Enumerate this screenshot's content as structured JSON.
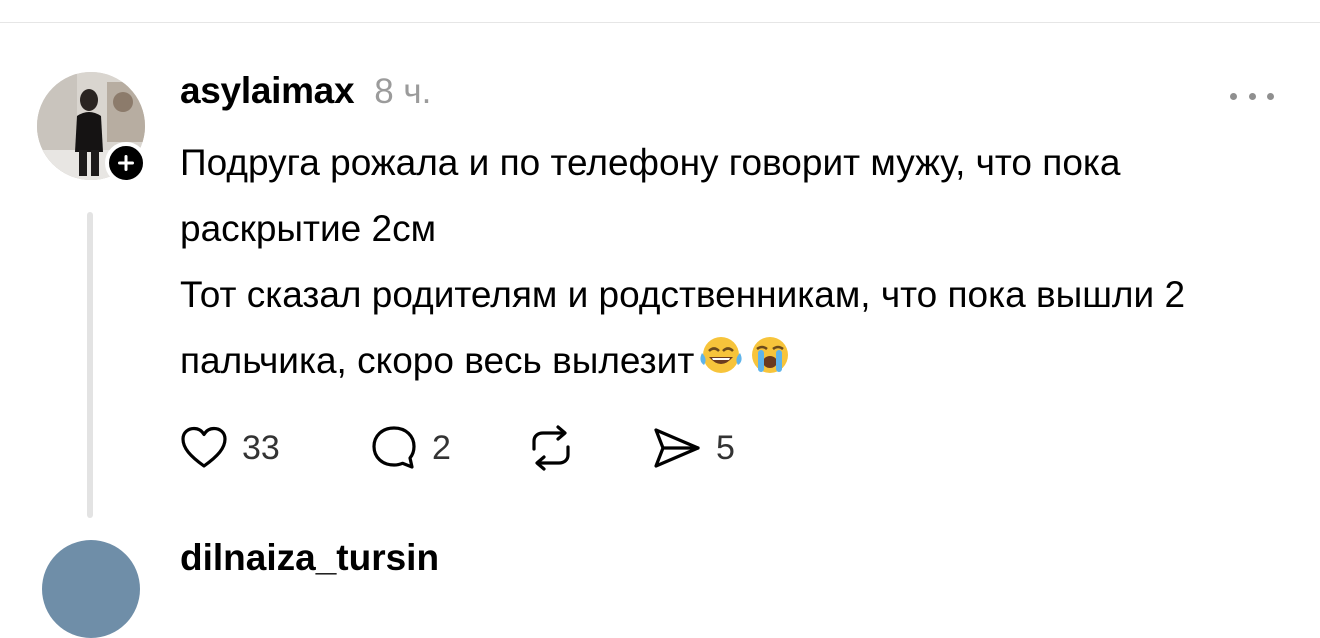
{
  "post": {
    "username": "asylaimax",
    "time": "8 ч.",
    "paragraph1": "Подруга рожала и по телефону говорит мужу, что пока раскрытие 2см",
    "paragraph2": "Тот сказал родителям и родственникам, что пока вышли 2 пальчика, скоро весь вылезит",
    "emojis": [
      "face-with-tears-of-joy",
      "loudly-crying-face"
    ],
    "likes": "33",
    "replies": "2",
    "shares": "5"
  },
  "next_post": {
    "username": "dilnaiza_tursin"
  },
  "icons": {
    "like": "heart-icon",
    "reply": "comment-bubble-icon",
    "repost": "repost-icon",
    "share": "share-arrow-icon",
    "more": "more-dots-icon",
    "follow": "plus-icon"
  },
  "colors": {
    "text": "#000000",
    "secondary": "#9b9b9b",
    "divider": "#e6e6e6",
    "thread_line": "#e3e3e3"
  }
}
